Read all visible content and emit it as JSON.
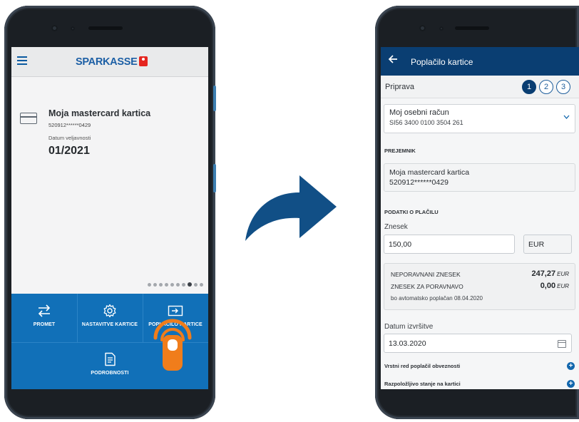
{
  "left_screen": {
    "brand": "SPARKASSE",
    "card": {
      "title": "Moja mastercard kartica",
      "number": "520912******0429",
      "validity_label": "Datum veljavnosti",
      "validity_value": "01/2021"
    },
    "carousel": {
      "count": 10,
      "active_index": 7
    },
    "actions": [
      {
        "label": "PROMET",
        "icon": "transfer-arrows-icon"
      },
      {
        "label": "NASTAVITVE KARTICE",
        "icon": "gear-icon"
      },
      {
        "label": "POPLAČILO KARTICE",
        "icon": "card-payment-icon"
      },
      {
        "label": "PODROBNOSTI",
        "icon": "document-icon"
      }
    ],
    "tap_indicator_icon": "tap-hand-icon"
  },
  "transition_icon": "curved-arrow-icon",
  "right_screen": {
    "title": "Poplačilo kartice",
    "step_label": "Priprava",
    "steps": [
      "1",
      "2",
      "3"
    ],
    "active_step": 1,
    "account": {
      "name": "Moj osebni račun",
      "iban": "SI56 3400 0100 3504 261"
    },
    "recipient_section": "PREJEMNIK",
    "recipient": {
      "name": "Moja mastercard kartica",
      "number": "520912******0429"
    },
    "payment_section": "PODATKI O PLAČILU",
    "amount_label": "Znesek",
    "amount_value": "150,00",
    "currency": "EUR",
    "info": {
      "unpaid_label": "NEPORAVNANI ZNESEK",
      "unpaid_value": "247,27",
      "unpaid_currency": "EUR",
      "due_label": "ZNESEK ZA PORAVNAVO",
      "due_value": "0,00",
      "due_currency": "EUR",
      "note": "bo avtomatsko poplačan 08.04.2020"
    },
    "date_label": "Datum izvršitve",
    "date_value": "13.03.2020",
    "expanders": [
      "Vrstni red poplačil obveznosti",
      "Razpoložljivo stanje na kartici"
    ]
  }
}
